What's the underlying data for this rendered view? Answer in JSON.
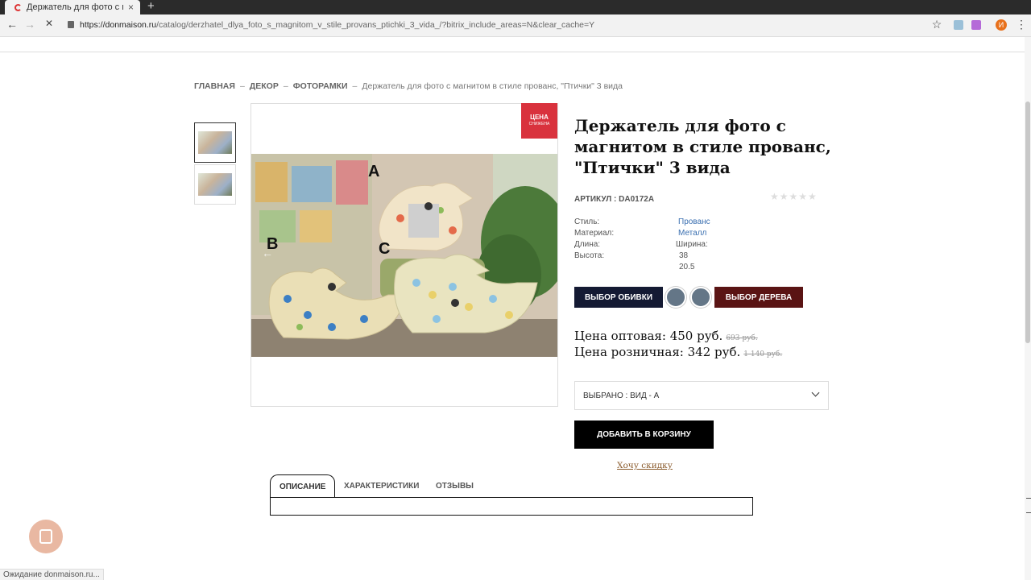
{
  "browser": {
    "tab_title": "Держатель для фото с м",
    "close_label": "×",
    "new_tab_label": "+",
    "url_domain": "https://donmaison.ru",
    "url_path": "/catalog/derzhatel_dlya_foto_s_magnitom_v_stile_provans_ptichki_3_vida_/?bitrix_include_areas=N&clear_cache=Y",
    "back_icon": "←",
    "forward_icon": "→",
    "reload_icon": "✕",
    "star_icon": "☆",
    "menu_icon": "⋮",
    "avatar_letter": "И",
    "status_text": "Ожидание donmaison.ru..."
  },
  "breadcrumb": {
    "items": [
      "ГЛАВНАЯ",
      "ДЕКОР",
      "ФОТОРАМКИ"
    ],
    "separator": "–",
    "current": "Держатель для фото с магнитом в стиле прованс, \"Птички\" 3 вида"
  },
  "gallery": {
    "labels": [
      "A",
      "B",
      "C"
    ],
    "prev_arrow": "←"
  },
  "badge": {
    "line1": "ЦЕНА",
    "line2": "СНИЖЕНА"
  },
  "product": {
    "title": "Держатель для фото с магнитом в стиле прованс, \"Птички\" 3 вида",
    "sku": "АРТИКУЛ : DA0172A",
    "stars": "★★★★★",
    "props": {
      "style_label": "Стиль:",
      "style_value": "Прованс",
      "material_label": "Материал:",
      "material_value": "Металл",
      "length_label": "Длина:",
      "width_label": "Ширина:",
      "height_label": "Высота:",
      "width_value": "38",
      "height_value": "20.5"
    },
    "upholstery_button": "ВЫБОР ОБИВКИ",
    "wood_button": "ВЫБОР ДЕРЕВА",
    "wholesale_price": "Цена оптовая: 450 руб.",
    "wholesale_old": "693 руб.",
    "retail_price": "Цена розничная: 342 руб.",
    "retail_old": "1 140 руб.",
    "selected_variant": "ВЫБРАНО : ВИД - А",
    "add_to_cart": "ДОБАВИТЬ В КОРЗИНУ",
    "want_discount": "Хочу скидку"
  },
  "tabs": [
    "ОПИСАНИЕ",
    "ХАРАКТЕРИСТИКИ",
    "ОТЗЫВЫ"
  ],
  "colors": {
    "navy_button": "#141a33",
    "wood_button": "#5a1414",
    "badge": "#d9323d",
    "swatch": "#647687",
    "link": "#3a6fb0"
  }
}
